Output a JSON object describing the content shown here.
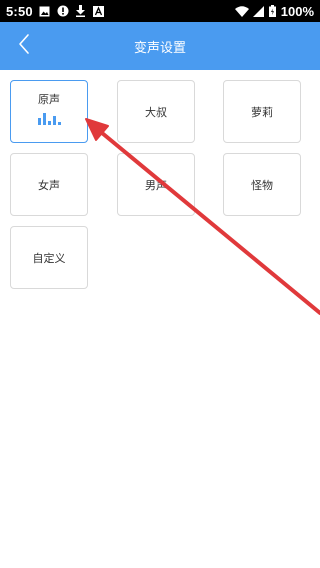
{
  "status_bar": {
    "time": "5:50",
    "battery": "100%",
    "icons_left": [
      "image-icon",
      "alert-icon",
      "download-icon",
      "font-icon"
    ],
    "icons_right": [
      "wifi-icon",
      "signal-icon",
      "battery-icon"
    ]
  },
  "header": {
    "title": "变声设置",
    "back_icon": "chevron-left-icon",
    "background": "#4a9bf0"
  },
  "voice_options": [
    {
      "label": "原声",
      "selected": true
    },
    {
      "label": "大叔",
      "selected": false
    },
    {
      "label": "萝莉",
      "selected": false
    },
    {
      "label": "女声",
      "selected": false
    },
    {
      "label": "男声",
      "selected": false
    },
    {
      "label": "怪物",
      "selected": false
    },
    {
      "label": "自定义",
      "selected": false
    }
  ],
  "colors": {
    "accent": "#4a9bf0",
    "card_border": "#d9d9d9",
    "annotation_arrow": "#e0393b"
  }
}
